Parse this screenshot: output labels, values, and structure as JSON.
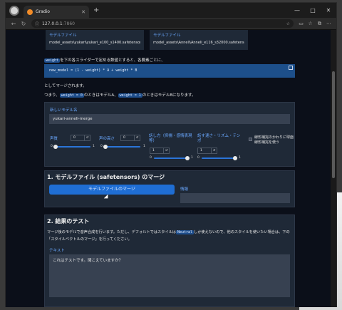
{
  "browser": {
    "tab_title": "Gradio",
    "url_host": "127.0.0.1",
    "url_path": ":7860",
    "new_tab_symbol": "+",
    "window_controls": [
      "—",
      "□",
      "✕"
    ]
  },
  "models": {
    "model1_label": "モデルファイル",
    "model1_value": "model_assets\\yukari\\yukari_e100_s1400.safetensors",
    "model2_label": "モデルファイル",
    "model2_value": "model_assets\\Anneli\\Anneli_e116_s32000.safetensors"
  },
  "explanation": {
    "line1_code": "weight",
    "line1_text": "を下の各スライダーで定める数値とすると、各要素ごとに、",
    "formula": "new_model = (1 - weight) * A + weight * B",
    "line2": "としてマージされます。",
    "line3_a": "つまり、",
    "line3_code1": "weight = 0",
    "line3_b": "のときはモデルA、",
    "line3_code2": "weight = 1",
    "line3_c": "のときはモデルBになります。"
  },
  "merge_settings": {
    "new_model_label": "新しいモデル名",
    "new_model_value": "yukari-anneli-merge",
    "sliders": [
      {
        "label": "声質",
        "value": "0",
        "min": "0",
        "max": "1",
        "fraction": 0.0
      },
      {
        "label": "声の高さ",
        "value": "0",
        "min": "0",
        "max": "1",
        "fraction": 0.0
      },
      {
        "label": "話し方（抑揚・感情表現等）",
        "value": "1",
        "min": "0",
        "max": "1",
        "fraction": 1.0
      },
      {
        "label": "話す速さ・リズム・テンポ",
        "value": "1",
        "min": "0",
        "max": "1",
        "fraction": 1.0
      }
    ],
    "checkbox_label": "線形補完のかわりに球面線形補完を使う"
  },
  "section1": {
    "title": "1. モデルファイル (safetensors) のマージ",
    "button_label": "モデルファイルのマージ",
    "info_label": "情報",
    "info_value": ""
  },
  "section2": {
    "title": "2. 結果のテスト",
    "desc_a": "マージ後のモデルで音声合成を行います。ただし、デフォルトではスタイルは",
    "desc_code": "Neutral",
    "desc_b": "しか使えないので、他のスタイルを使いたい場合は、下の",
    "desc_line2": "「スタイルベクトルのマージ」を行ってください。",
    "text_label": "テキスト",
    "text_value": "これはテストです。聞こえていますか？"
  }
}
